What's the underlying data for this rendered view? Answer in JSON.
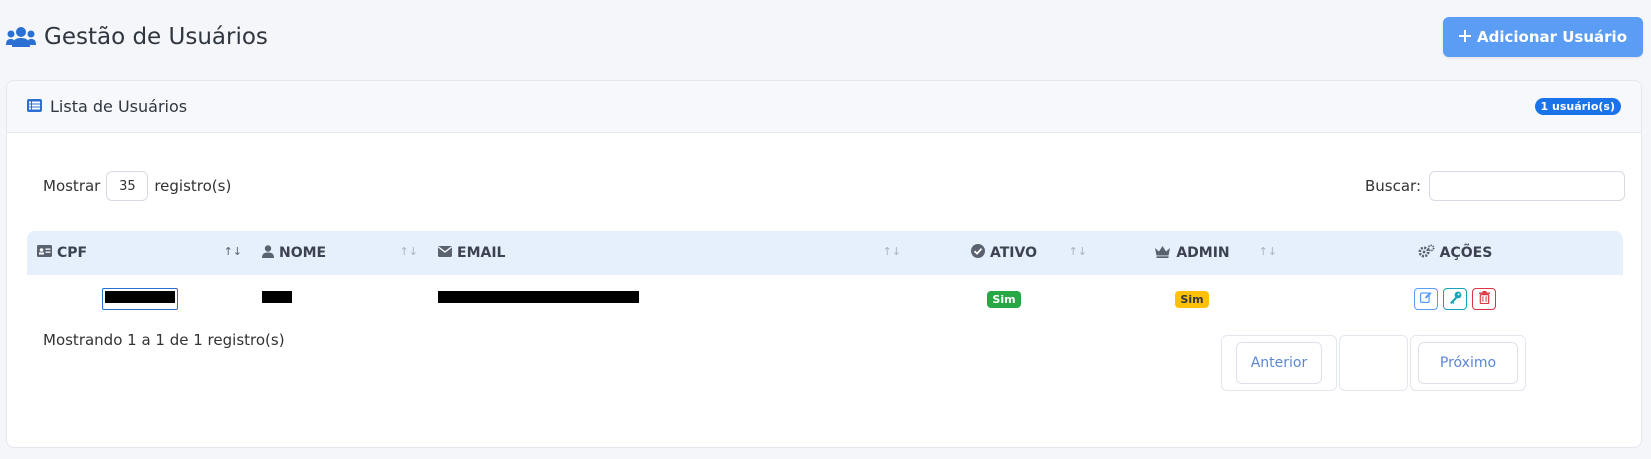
{
  "header": {
    "title": "Gestão de Usuários",
    "title_icon": "users-icon",
    "add_button_label": "Adicionar Usuário",
    "add_button_icon": "plus-icon"
  },
  "card": {
    "title": "Lista de Usuários",
    "title_icon": "list-icon",
    "count_badge": "1 usuário(s)"
  },
  "controls": {
    "show_label": "Mostrar",
    "page_length": "35",
    "records_label": "registro(s)",
    "search_label": "Buscar:",
    "search_value": ""
  },
  "table": {
    "columns": [
      {
        "label": "CPF",
        "icon": "id-card-icon"
      },
      {
        "label": "NOME",
        "icon": "user-icon"
      },
      {
        "label": "EMAIL",
        "icon": "envelope-icon"
      },
      {
        "label": "ATIVO",
        "icon": "check-circle-icon"
      },
      {
        "label": "ADMIN",
        "icon": "crown-icon"
      },
      {
        "label": "AÇÕES",
        "icon": "cogs-icon"
      }
    ],
    "sort_glyph": "↑↓",
    "rows": [
      {
        "ativo": "Sim",
        "admin": "Sim"
      }
    ]
  },
  "footer": {
    "info": "Mostrando 1 a 1 de 1 registro(s)",
    "prev_label": "Anterior",
    "next_label": "Próximo"
  },
  "colors": {
    "primary": "#5b9cf5",
    "badge_blue": "#1a73e8",
    "success": "#28a745",
    "warning": "#ffc107",
    "danger": "#dc3545",
    "info": "#17a2b8",
    "table_header_bg": "#e6effc"
  }
}
